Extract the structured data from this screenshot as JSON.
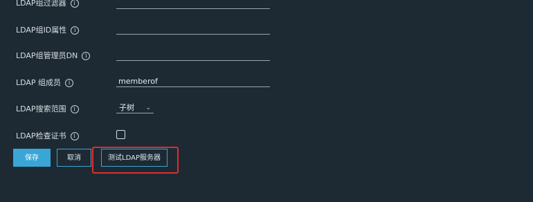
{
  "form": {
    "group_filter": {
      "label": "LDAP组过滤器",
      "value": ""
    },
    "group_id_attr": {
      "label": "LDAP组ID属性",
      "value": ""
    },
    "group_admin_dn": {
      "label": "LDAP组管理员DN",
      "value": ""
    },
    "group_member": {
      "label": "LDAP 组成员",
      "value": "memberof"
    },
    "search_scope": {
      "label": "LDAP搜索范围",
      "value": "子树"
    },
    "verify_cert": {
      "label": "LDAP检查证书",
      "checked": false
    }
  },
  "actions": {
    "save_label": "保存",
    "cancel_label": "取消",
    "test_label": "测试LDAP服务器"
  },
  "colors": {
    "background": "#1e2a33",
    "accent": "#3aa6d6",
    "highlight": "#e52b2b"
  },
  "icons": {
    "info": "info-circle-icon",
    "dropdown": "chevron-down-icon"
  }
}
